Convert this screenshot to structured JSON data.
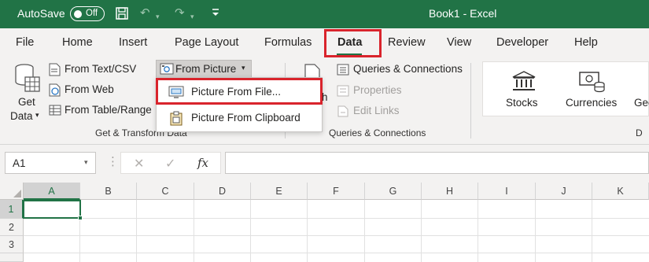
{
  "titlebar": {
    "autosave_label": "AutoSave",
    "autosave_state": "Off",
    "document_title": "Book1  -  Excel"
  },
  "tabs": [
    "File",
    "Home",
    "Insert",
    "Page Layout",
    "Formulas",
    "Data",
    "Review",
    "View",
    "Developer",
    "Help"
  ],
  "active_tab": "Data",
  "ribbon": {
    "get_data": {
      "line1": "Get",
      "line2": "Data"
    },
    "from_text_csv": "From Text/CSV",
    "from_web": "From Web",
    "from_table_range": "From Table/Range",
    "from_picture": "From Picture",
    "get_transform_label": "Get & Transform Data",
    "queries_connections": "Queries & Connections",
    "properties": "Properties",
    "edit_links": "Edit Links",
    "queries_label": "Queries & Connections",
    "refresh_partial": "h",
    "stocks": "Stocks",
    "currencies": "Currencies",
    "geography_partial": "Geo",
    "data_types_partial": "D"
  },
  "dropdown": {
    "picture_from_file": "Picture From File...",
    "picture_from_clipboard": "Picture From Clipboard"
  },
  "formula_bar": {
    "name_box": "A1",
    "fx": "fx",
    "value": ""
  },
  "sheet": {
    "columns": [
      "A",
      "B",
      "C",
      "D",
      "E",
      "F",
      "G",
      "H",
      "I",
      "J",
      "K"
    ],
    "rows": [
      "1",
      "2",
      "3"
    ],
    "active_cell": "A1"
  },
  "colors": {
    "excel_green": "#217346",
    "highlight_red": "#d9242c",
    "ribbon_bg": "#f3f2f1"
  }
}
